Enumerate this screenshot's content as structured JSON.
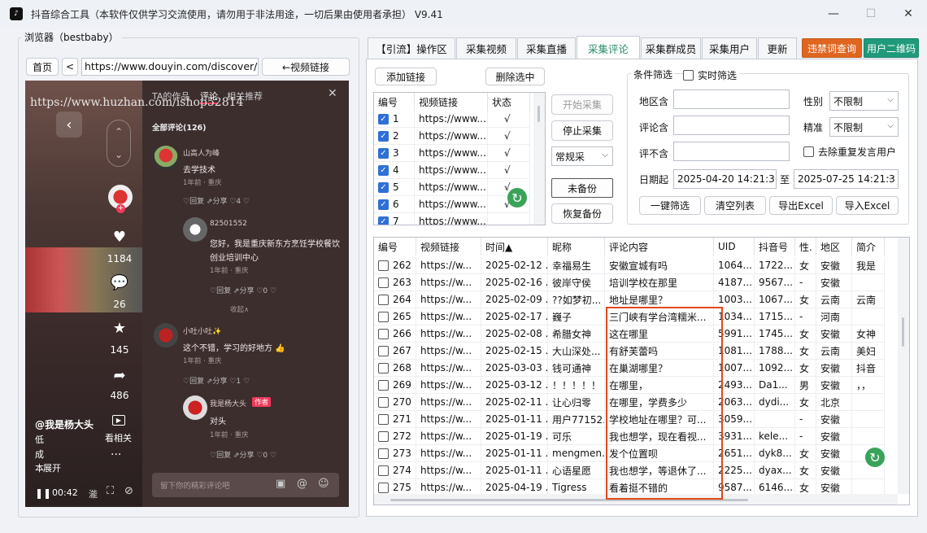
{
  "window": {
    "title": "抖音综合工具（本软件仅供学习交流使用，请勿用于非法用途，一切后果由使用者承担） V9.41",
    "minimize": "—",
    "maximize": "☐",
    "close": "✕"
  },
  "browser": {
    "legend": "浏览器（bestbaby）",
    "home": "首页",
    "back": "<",
    "url": "https://www.douyin.com/discover/kno",
    "video_link": "←视频链接"
  },
  "video": {
    "watermark": "https://www.huzhan.com/ishop52814",
    "tabs": [
      "TA的作品",
      "评论",
      "相关推荐"
    ],
    "all_comments": "全部评论(126)",
    "likes": "1184",
    "comments": "26",
    "favs": "145",
    "shares": "486",
    "author": "@我是杨大头",
    "desc": [
      "低",
      "成",
      "本"
    ],
    "expand": "展开",
    "related": "看相关",
    "time": "00:42",
    "input_placeholder": "留下你的精彩评论吧",
    "cmts": [
      {
        "user": "山高人为峰",
        "text": "去学技术",
        "meta": "1年前 · 重庆",
        "act": "♡回复  ⇗分享  ♡4  ♡"
      },
      {
        "user": "82501552",
        "text": "您好，我是重庆新东方烹饪学校餐饮",
        "text2": "创业培训中心",
        "meta": "1年前 · 重庆",
        "act": "♡回复  ⇗分享  ♡0  ♡"
      },
      {
        "user": "小吐小吐✨",
        "text": "这个不错，学习的好地方 👍",
        "meta": "1年前 · 重庆",
        "act": "♡回复  ⇗分享  ♡1  ♡"
      },
      {
        "user": "我是杨大头",
        "badge": "作者",
        "text": "对头",
        "meta": "1年前 · 重庆",
        "act": "♡回复  ⇗分享  ♡0  ♡"
      }
    ],
    "collapse": "收起∧"
  },
  "tabs": [
    "【引流】操作区",
    "采集视频",
    "采集直播",
    "采集评论",
    "采集群成员",
    "采集用户",
    "更新"
  ],
  "tab_active_index": 3,
  "btn_forbidden": "违禁词查询",
  "btn_qrcode": "用户二维码",
  "links": {
    "add": "添加链接",
    "delete": "删除选中",
    "headers": [
      "编号",
      "视频链接",
      "状态"
    ],
    "rows": [
      {
        "n": "1",
        "u": "https://www....",
        "s": "√"
      },
      {
        "n": "2",
        "u": "https://www....",
        "s": "√"
      },
      {
        "n": "3",
        "u": "https://www....",
        "s": "√"
      },
      {
        "n": "4",
        "u": "https://www....",
        "s": "√"
      },
      {
        "n": "5",
        "u": "https://www....",
        "s": "√"
      },
      {
        "n": "6",
        "u": "https://www....",
        "s": "√"
      },
      {
        "n": "7",
        "u": "https://www....",
        "s": ""
      }
    ]
  },
  "controls": {
    "start": "开始采集",
    "stop": "停止采集",
    "mode": "常规采",
    "backup": "未备份",
    "restore": "恢复备份"
  },
  "filter": {
    "legend": "条件筛选",
    "realtime": "实时筛选",
    "region_label": "地区含",
    "comment_label": "评论含",
    "exclude_label": "评不含",
    "gender_label": "性别",
    "gender": "不限制",
    "precise_label": "精准",
    "precise": "不限制",
    "dedupe": "去除重复发言用户",
    "date_label": "日期起",
    "date_from": "2025-04-20 14:21:3",
    "to": "至",
    "date_to": "2025-07-25 14:21:3",
    "btn_filter": "一键筛选",
    "btn_clear": "清空列表",
    "btn_export": "导出Excel",
    "btn_import": "导入Excel"
  },
  "table": {
    "headers": [
      "编号",
      "视频链接",
      "时间▲",
      "昵称",
      "评论内容",
      "UID",
      "抖音号",
      "性.",
      "地区",
      "简介"
    ],
    "rows": [
      [
        "262",
        "https://w...",
        "2025-02-12 ...",
        "幸福易生",
        "安徽宣城有吗",
        "1064...",
        "1722...",
        "女",
        "安徽",
        "我是"
      ],
      [
        "263",
        "https://w...",
        "2025-02-16 ...",
        "彼岸守侯",
        "培训学校在那里",
        "4187...",
        "9567...",
        "-",
        "安徽",
        ""
      ],
      [
        "264",
        "https://w...",
        "2025-02-09 ...",
        "??如梦初...",
        "地址是哪里？",
        "1003...",
        "1067...",
        "女",
        "云南",
        "云南"
      ],
      [
        "265",
        "https://w...",
        "2025-02-17 ...",
        "巍子",
        "三门峡有学台湾糯米...",
        "1034...",
        "1715...",
        "-",
        "河南",
        ""
      ],
      [
        "266",
        "https://w...",
        "2025-02-08 ...",
        "希腊女神",
        "这在哪里",
        "5991...",
        "1745...",
        "女",
        "安徽",
        "女神"
      ],
      [
        "267",
        "https://w...",
        "2025-02-15 ...",
        "大山深处...",
        "有舒芙蕾吗",
        "1081...",
        "1788...",
        "女",
        "云南",
        "美妇"
      ],
      [
        "268",
        "https://w...",
        "2025-03-03 ...",
        "钱可通神",
        "在巢湖哪里？",
        "1007...",
        "1092...",
        "女",
        "安徽",
        "抖音"
      ],
      [
        "269",
        "https://w...",
        "2025-03-12 ...",
        "！！！！！",
        "在哪里，",
        "2493...",
        "Da1...",
        "男",
        "安徽",
        "，，"
      ],
      [
        "270",
        "https://w...",
        "2025-02-11 ...",
        "让心归零",
        "在哪里，学费多少",
        "2063...",
        "dydi...",
        "女",
        "北京",
        ""
      ],
      [
        "271",
        "https://w...",
        "2025-01-11 ...",
        "用户77152...",
        "学校地址在哪里？可...",
        "3059...",
        "",
        "-",
        "安徽",
        ""
      ],
      [
        "272",
        "https://w...",
        "2025-01-19 ...",
        "可乐",
        "我也想学，现在看视...",
        "3931...",
        "kele...",
        "-",
        "安徽",
        ""
      ],
      [
        "273",
        "https://w...",
        "2025-01-11 ...",
        "mengmen...",
        "发个位置呗",
        "2651...",
        "dyk8...",
        "女",
        "安徽",
        ""
      ],
      [
        "274",
        "https://w...",
        "2025-01-11 ...",
        "心语星愿",
        "我也想学，等退休了...",
        "2225...",
        "dyax...",
        "女",
        "安徽",
        ""
      ],
      [
        "275",
        "https://w...",
        "2025-04-19 ...",
        "Tigress",
        "看着挺不错的",
        "9587...",
        "6146...",
        "女",
        "安徽",
        ""
      ]
    ]
  },
  "colors": {
    "accent_green": "#2a8a6a",
    "orange": "#e0651f",
    "teal": "#1f9a7a",
    "highlight": "#e04a1a"
  }
}
